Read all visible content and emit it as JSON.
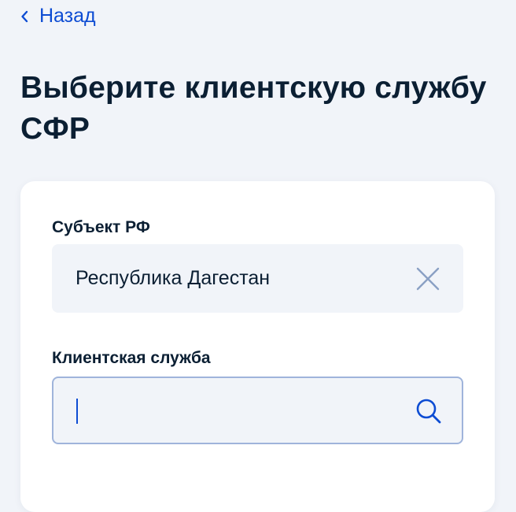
{
  "nav": {
    "back_label": "Назад"
  },
  "page": {
    "title": "Выберите клиентскую службу СФР"
  },
  "form": {
    "region": {
      "label": "Субъект РФ",
      "value": "Республика Дагестан",
      "clear_icon": "close-icon"
    },
    "service": {
      "label": "Клиентская служба",
      "value": "",
      "placeholder": "",
      "search_icon": "search-icon"
    }
  },
  "colors": {
    "accent": "#0d4cd3",
    "text": "#0b1f33",
    "page_background": "#f1f4f9",
    "field_background": "#f1f4f9",
    "field_border_focus": "#9fb4db",
    "icon": "#8aa0c4"
  }
}
